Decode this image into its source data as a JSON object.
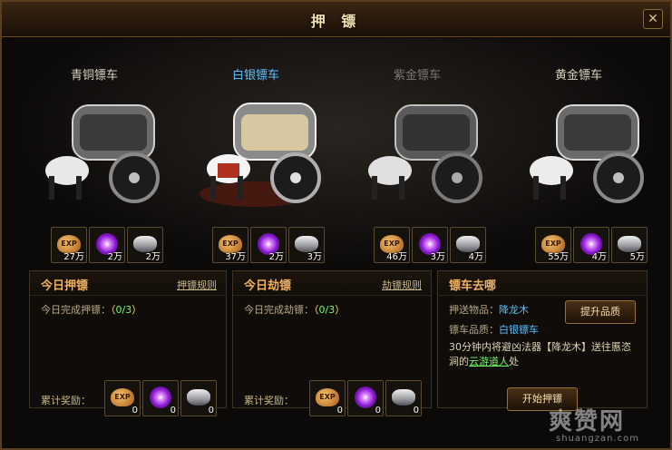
{
  "window": {
    "title": "押 镖"
  },
  "carts": [
    {
      "name": "青铜镖车",
      "state": "normal",
      "rewards": [
        "27万",
        "2万",
        "2万"
      ]
    },
    {
      "name": "白银镖车",
      "state": "selected",
      "rewards": [
        "37万",
        "2万",
        "3万"
      ]
    },
    {
      "name": "紫金镖车",
      "state": "dim",
      "rewards": [
        "46万",
        "3万",
        "4万"
      ]
    },
    {
      "name": "黄金镖车",
      "state": "normal",
      "rewards": [
        "55万",
        "4万",
        "5万"
      ]
    }
  ],
  "reward_icons": {
    "exp": "EXP",
    "orb": "purple-orb-icon",
    "silver": "silver-ingot-icon"
  },
  "escort_panel": {
    "title": "今日押镖",
    "link": "押镖规则",
    "progress_label": "今日完成押镖：",
    "progress_open": "（",
    "progress_value": "0/3",
    "progress_close": "）",
    "reward_label": "累计奖励：",
    "reward_counts": [
      "0",
      "0",
      "0"
    ]
  },
  "rob_panel": {
    "title": "今日劫镖",
    "link": "劫镖规则",
    "progress_label": "今日完成劫镖：",
    "progress_open": "（",
    "progress_value": "0/3",
    "progress_close": "）",
    "reward_label": "累计奖励：",
    "reward_counts": [
      "0",
      "0",
      "0"
    ]
  },
  "destination_panel": {
    "title": "镖车去哪",
    "item_label": "押送物品：",
    "item_value": "降龙木",
    "quality_label": "镖车品质：",
    "quality_value": "白银镖车",
    "upgrade_button": "提升品质",
    "desc_prefix": "30分钟内将避凶法器【降龙木】送往慝恣涧的",
    "desc_link": "云游道人",
    "desc_suffix": "处",
    "start_button": "开始押镖"
  },
  "watermark": {
    "big": "爽赞网",
    "small": "shuangzan.com"
  },
  "colors": {
    "accent": "#f0b060",
    "selected": "#58c0ff",
    "progress": "#70ff60"
  }
}
